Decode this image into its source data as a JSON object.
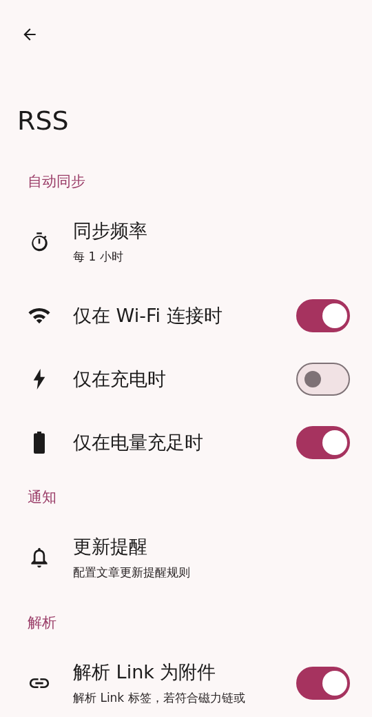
{
  "title": "RSS",
  "sections": [
    {
      "header": "自动同步",
      "items": [
        {
          "kind": "nav",
          "title": "同步频率",
          "subtitle": "每 1 小时"
        },
        {
          "kind": "switch",
          "title": "仅在 Wi-Fi 连接时",
          "on": true
        },
        {
          "kind": "switch",
          "title": "仅在充电时",
          "on": false
        },
        {
          "kind": "switch",
          "title": "仅在电量充足时",
          "on": true
        }
      ]
    },
    {
      "header": "通知",
      "items": [
        {
          "kind": "nav",
          "title": "更新提醒",
          "subtitle": "配置文章更新提醒规则"
        }
      ]
    },
    {
      "header": "解析",
      "items": [
        {
          "kind": "switch",
          "title": "解析 Link 为附件",
          "subtitle": "解析 Link 标签，若符合磁力链或",
          "on": true
        }
      ]
    }
  ]
}
